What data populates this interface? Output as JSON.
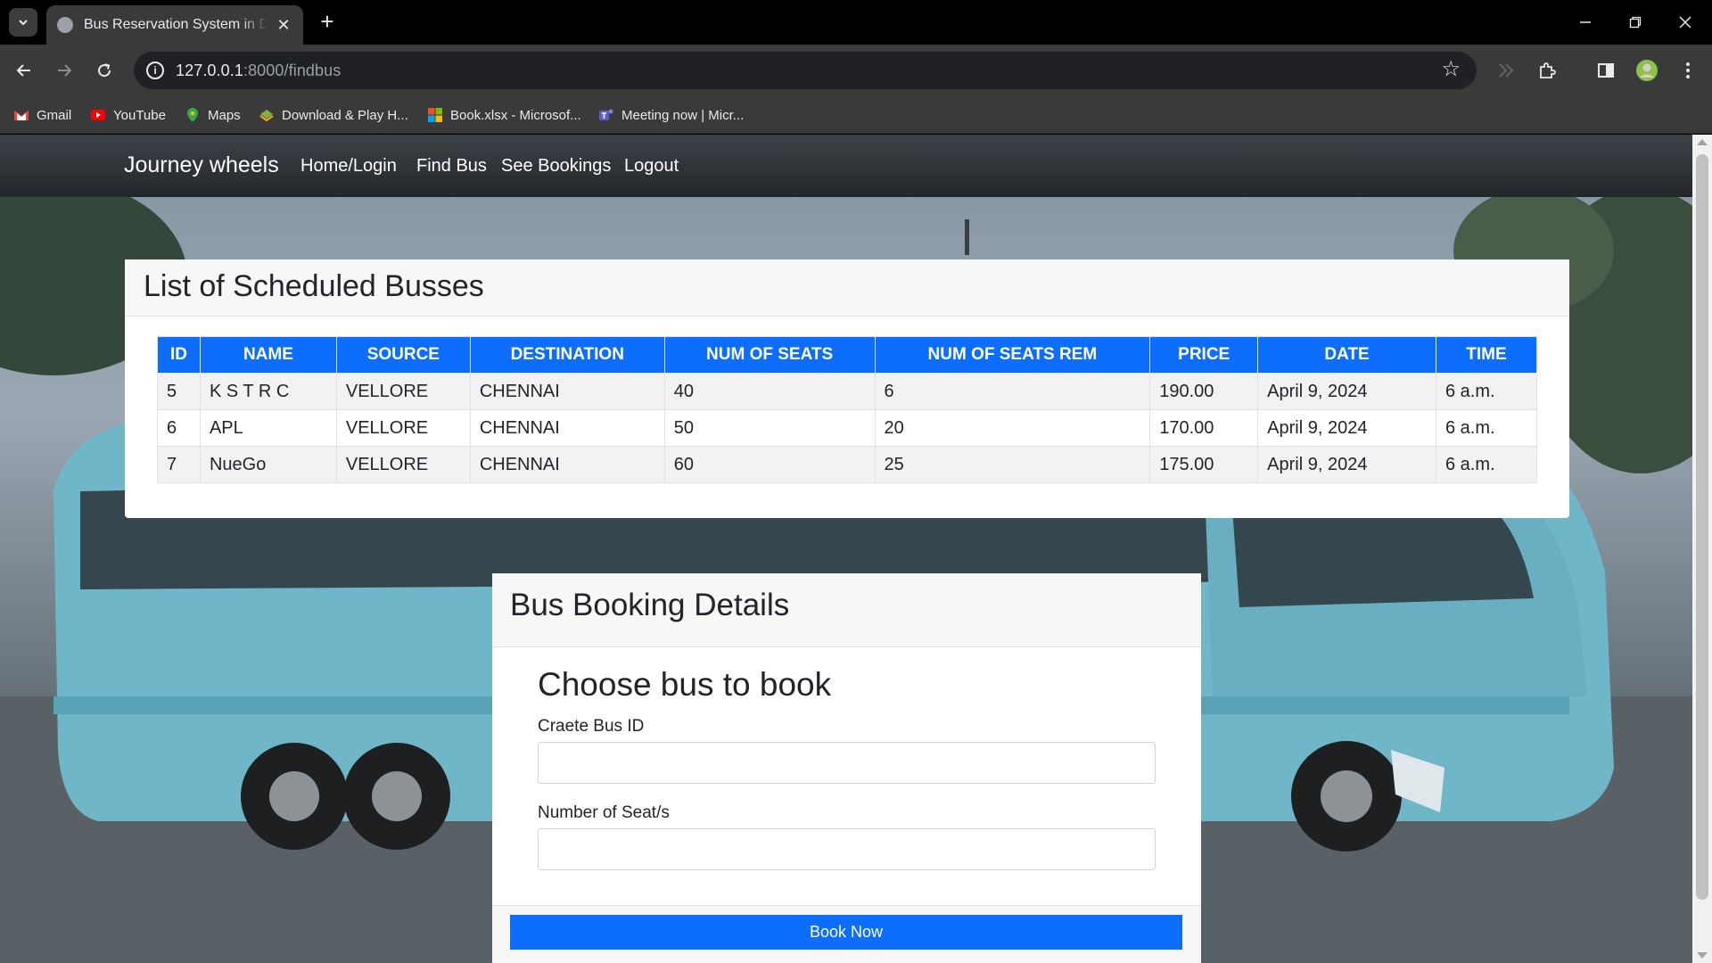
{
  "browser": {
    "tab_title": "Bus Reservation System in Django",
    "tab_close": "✕",
    "new_tab": "+",
    "url_host": "127.0.0.1",
    "url_path": ":8000/findbus",
    "bookmarks": [
      {
        "label": "Gmail",
        "icon": "gmail-icon"
      },
      {
        "label": "YouTube",
        "icon": "youtube-icon"
      },
      {
        "label": "Maps",
        "icon": "maps-icon"
      },
      {
        "label": "Download & Play H...",
        "icon": "game-icon"
      },
      {
        "label": "Book.xlsx - Microsof...",
        "icon": "microsoft-icon"
      },
      {
        "label": "Meeting now | Micr...",
        "icon": "teams-icon"
      }
    ]
  },
  "navbar": {
    "brand": "Journey wheels",
    "links": [
      "Home/Login",
      "Find Bus",
      "See Bookings",
      "Logout"
    ]
  },
  "bus_list": {
    "title": "List of Scheduled Busses",
    "columns": [
      "ID",
      "NAME",
      "SOURCE",
      "DESTINATION",
      "NUM OF SEATS",
      "NUM OF SEATS REM",
      "PRICE",
      "DATE",
      "TIME"
    ],
    "rows": [
      [
        "5",
        "K S T R C",
        "VELLORE",
        "CHENNAI",
        "40",
        "6",
        "190.00",
        "April 9, 2024",
        "6 a.m."
      ],
      [
        "6",
        "APL",
        "VELLORE",
        "CHENNAI",
        "50",
        "20",
        "170.00",
        "April 9, 2024",
        "6 a.m."
      ],
      [
        "7",
        "NueGo",
        "VELLORE",
        "CHENNAI",
        "60",
        "25",
        "175.00",
        "April 9, 2024",
        "6 a.m."
      ]
    ]
  },
  "booking": {
    "title": "Bus Booking Details",
    "subtitle": "Choose bus to book",
    "bus_id_label": "Craete Bus ID",
    "bus_id_value": "",
    "seats_label": "Number of Seat/s",
    "seats_value": "",
    "button": "Book Now"
  },
  "colors": {
    "primary": "#0d6efd",
    "navbar": "#343a40"
  }
}
